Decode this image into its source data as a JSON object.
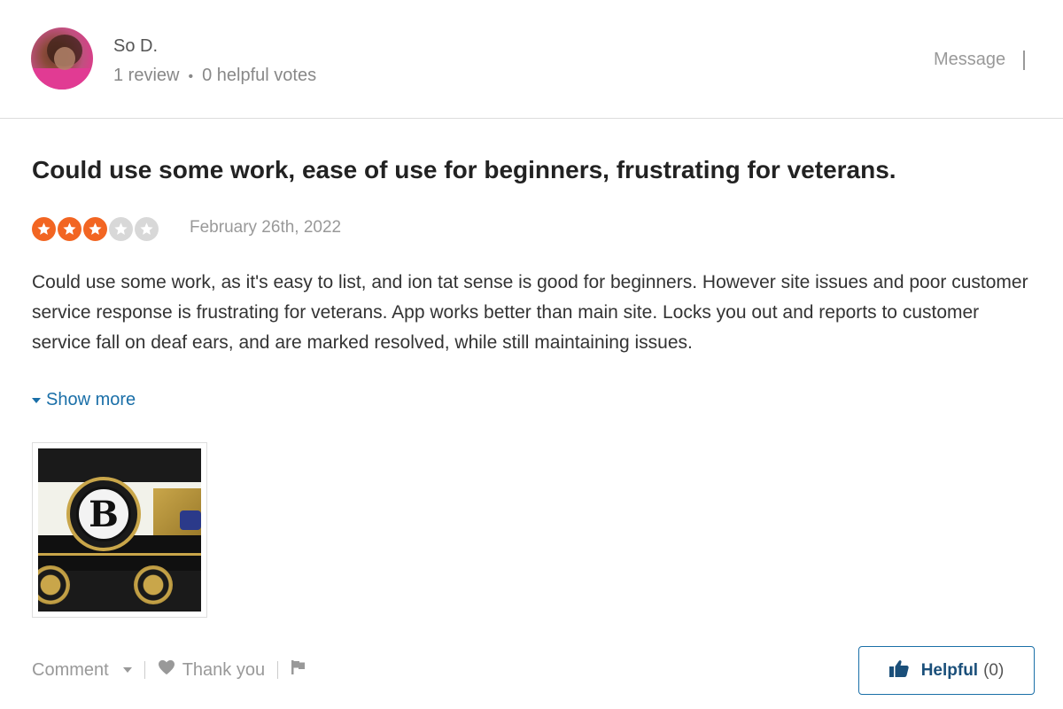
{
  "user": {
    "name": "So D.",
    "reviews": "1 review",
    "separator": "•",
    "helpful_votes": "0 helpful votes",
    "message_label": "Message"
  },
  "review": {
    "title": "Could use some work, ease of use for beginners, frustrating for veterans.",
    "rating": 3,
    "rating_max": 5,
    "date": "February 26th, 2022",
    "body": "Could use some work, as it's easy to list, and ion tat sense is good for beginners. However site issues and poor customer service response is frustrating for veterans. App works better than main site. Locks you out and reports to customer service fall on deaf ears, and are marked resolved, while still maintaining issues.",
    "show_more_label": "Show more"
  },
  "actions": {
    "comment_label": "Comment",
    "thank_you_label": "Thank you",
    "helpful_label": "Helpful",
    "helpful_count": "(0)"
  },
  "icons": {
    "star": "star-icon",
    "heart": "heart-icon",
    "flag": "flag-icon",
    "thumbs_up": "thumbs-up-icon"
  },
  "colors": {
    "star_filled": "#f26522",
    "star_empty": "#d8d8d8",
    "link": "#1a6fa8",
    "helpful_text": "#1a4f7a"
  }
}
